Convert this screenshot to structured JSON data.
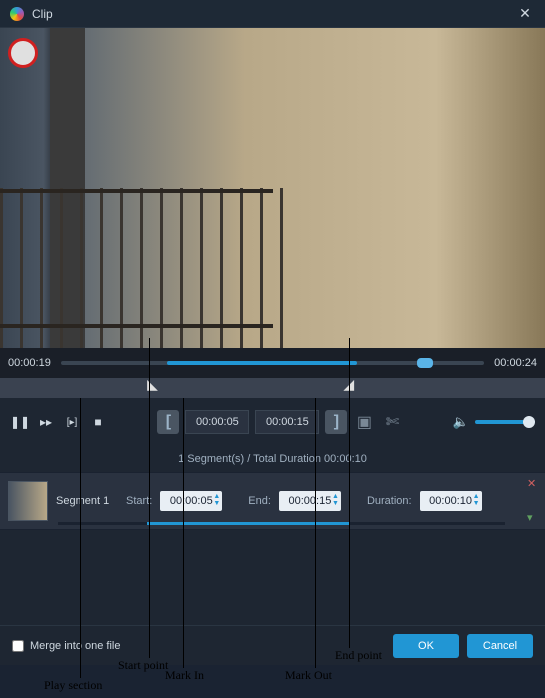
{
  "window": {
    "title": "Clip"
  },
  "playback": {
    "current_time": "00:00:19",
    "total_time": "00:00:24",
    "mark_in": "00:00:05",
    "mark_out": "00:00:15"
  },
  "segment_info": "1 Segment(s) / Total Duration 00:00:10",
  "segment": {
    "name": "Segment 1",
    "start_label": "Start:",
    "start_value": "00:00:05",
    "end_label": "End:",
    "end_value": "00:00:15",
    "duration_label": "Duration:",
    "duration_value": "00:00:10"
  },
  "footer": {
    "merge_label": "Merge into one file",
    "ok": "OK",
    "cancel": "Cancel"
  },
  "annotations": {
    "play_section": "Play section",
    "start_point": "Start point",
    "mark_in": "Mark In",
    "mark_out": "Mark Out",
    "end_point": "End point"
  }
}
